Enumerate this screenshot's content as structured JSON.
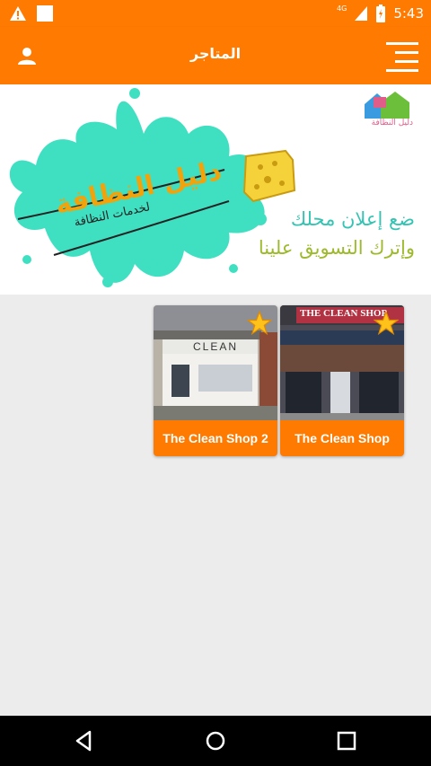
{
  "status_bar": {
    "time": "5:43",
    "network": "4G",
    "icons": [
      "warning-icon",
      "square-notification-icon",
      "signal-icon",
      "battery-icon"
    ]
  },
  "app_bar": {
    "title": "المتاجر",
    "color": "#ff7a00",
    "icons": [
      "profile-icon",
      "menu-icon"
    ]
  },
  "banner": {
    "logo_title": "دليل النظافة",
    "logo_subtitle": "لخدمات النظافة",
    "brand_small": "دليل النظافة",
    "tagline_1": "ضع إعلان محلك",
    "tagline_2": "وإترك التسويق علينا",
    "colors": {
      "splash": "#3fe0c2",
      "title": "#f2a20a",
      "tagline_1": "#35c4b3",
      "tagline_2": "#9dba2c"
    }
  },
  "shops": [
    {
      "name": "The Clean Shop",
      "sign": "THE CLEAN SHOP",
      "favorite_icon": "star-icon"
    },
    {
      "name": "The Clean Shop 2",
      "sign": "CLEAN",
      "favorite_icon": "star-icon"
    }
  ],
  "nav_bar": {
    "icons": [
      "back-icon",
      "home-icon",
      "recents-icon"
    ]
  }
}
